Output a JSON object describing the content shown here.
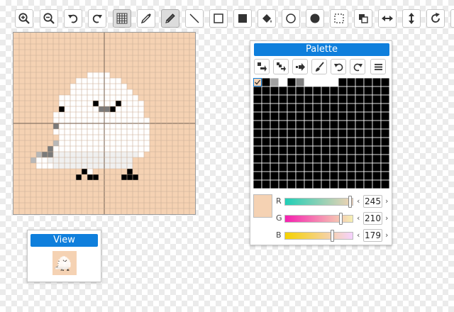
{
  "toolbar": {
    "tools": [
      {
        "name": "zoom-in-icon",
        "active": false
      },
      {
        "name": "zoom-out-icon",
        "active": false
      },
      {
        "name": "undo-icon",
        "active": false
      },
      {
        "name": "redo-icon",
        "active": false
      },
      {
        "name": "grid-icon",
        "active": true
      },
      {
        "name": "eyedropper-icon",
        "active": false
      },
      {
        "name": "pencil-icon",
        "active": true
      },
      {
        "name": "line-icon",
        "active": false
      },
      {
        "name": "rectangle-outline-icon",
        "active": false
      },
      {
        "name": "rectangle-filled-icon",
        "active": false
      },
      {
        "name": "fill-bucket-icon",
        "active": false
      },
      {
        "name": "ellipse-outline-icon",
        "active": false
      },
      {
        "name": "ellipse-filled-icon",
        "active": false
      },
      {
        "name": "select-icon",
        "active": false
      },
      {
        "name": "copy-icon",
        "active": false
      },
      {
        "name": "flip-horizontal-icon",
        "active": false
      },
      {
        "name": "flip-vertical-icon",
        "active": false
      },
      {
        "name": "rotate-icon",
        "active": false
      }
    ]
  },
  "canvas": {
    "background_color": "#f5d2b3",
    "grid_color": "#c9ad96",
    "guide_color": "#8a7565",
    "pixels_per_side": 32,
    "colors": {
      "W": "#ffffff",
      "L": "#f0f0f0",
      "K": "#000000",
      "G": "#7a7a7a",
      "S": "#b8b8b8"
    },
    "art": [
      "................................",
      "................................",
      "................................",
      "................................",
      "................................",
      "................................",
      "................................",
      ".............WWWW...............",
      "...........WWWWWWWW.............",
      "..........WWWWWWWWWW............",
      "..........WWWWWWWWWWW...........",
      "........WWWWWWWWWWWWWW..........",
      "........WWWWWWKWWWKWWWW.........",
      "........KWWWWWWGGKWWWWW.........",
      ".......WWWWWWWWWWWWWWWW.........",
      ".......WWWWWWWWWWWWWWWWW........",
      ".......GWWWWWWWWWWWWWWWW........",
      ".......WWWWWWWWWWWWWWWWW........",
      "........WWWWWWWWWWWWWWWW........",
      ".......SWWWWWWWWWWWWWWWW........",
      "......GWWWWWWWWWWWWWWWWW........",
      "....SGGLLLLLLLLLLLLLLLW.........",
      "...SWWLLLLLLLLLLLLLLL...........",
      "....WWWLLLLLLLLLLLLLL...........",
      "............KW......K...........",
      "...........K.KK....KKK..........",
      "................................",
      "................................",
      "................................",
      "................................",
      "................................",
      "................................"
    ]
  },
  "view_panel": {
    "title": "View"
  },
  "palette_panel": {
    "title": "Palette",
    "tools": [
      "move-selection-icon",
      "shift-selection-icon",
      "arrow-right-icon",
      "brush-icon",
      "undo-icon",
      "redo-icon",
      "menu-icon"
    ],
    "swatch_colors": [
      "#f5d2b3",
      "#000000",
      "#a0a0a0",
      "#ffffff",
      "#000000",
      "#7f7f7f",
      "#ffffff",
      "#ffffff",
      "#ffffff",
      "#ffffff"
    ],
    "default_swatch": "#000000",
    "selected_swatch_index": 0,
    "current_color": "#f5d2b3",
    "channels": [
      {
        "label": "R",
        "value": "245",
        "gradient": [
          "#1fcfb7",
          "#f5d2b3"
        ]
      },
      {
        "label": "G",
        "value": "210",
        "gradient": [
          "#f51fb0",
          "#f5f0b3"
        ]
      },
      {
        "label": "B",
        "value": "179",
        "gradient": [
          "#f5d200",
          "#f5d2ff"
        ]
      }
    ],
    "decrement_glyph": "‹",
    "increment_glyph": "›"
  }
}
